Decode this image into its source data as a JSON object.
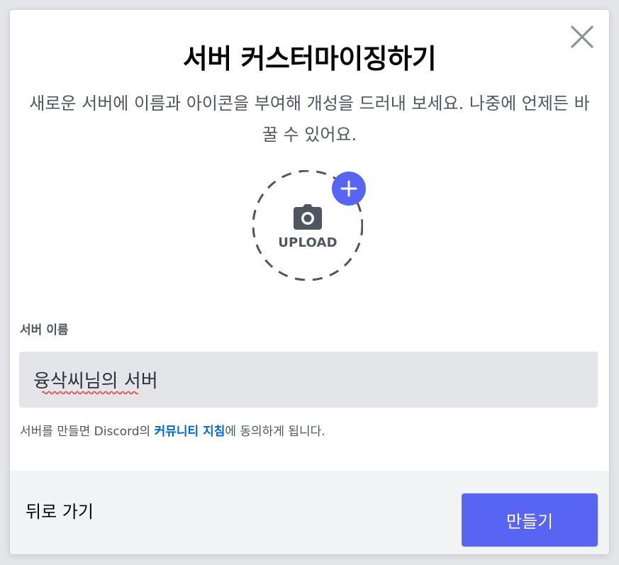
{
  "modal": {
    "title": "서버 커스터마이징하기",
    "subtitle": "새로운 서버에 이름과 아이콘을 부여해 개성을 드러내 보세요. 나중에 언제든 바꿀 수 있어요.",
    "close_icon": "close-icon"
  },
  "upload": {
    "label": "UPLOAD",
    "camera_icon": "camera-icon",
    "plus_icon": "plus-icon"
  },
  "server_name": {
    "label": "서버 이름",
    "value": "융삭씨님의 서버"
  },
  "terms": {
    "prefix": "서버를 만들면 Discord의 ",
    "link": "커뮤니티 지침",
    "suffix": "에 동의하게 됩니다."
  },
  "footer": {
    "back_label": "뒤로 가기",
    "create_label": "만들기"
  },
  "colors": {
    "accent": "#5865f2",
    "link": "#0068e0",
    "input_bg": "#e3e5e8",
    "footer_bg": "#f2f3f5"
  }
}
